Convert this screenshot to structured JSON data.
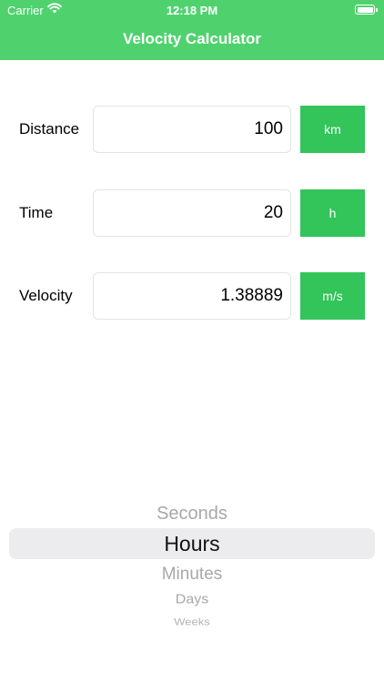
{
  "status_bar": {
    "carrier": "Carrier",
    "time": "12:18 PM",
    "wifi_icon": "wifi-icon",
    "battery_icon": "battery-icon"
  },
  "nav": {
    "title": "Velocity Calculator"
  },
  "colors": {
    "header": "#4fd26e",
    "unit_button": "#33c45a"
  },
  "rows": [
    {
      "label": "Distance",
      "value": "100",
      "unit": "km"
    },
    {
      "label": "Time",
      "value": "20",
      "unit": "h"
    },
    {
      "label": "Velocity",
      "value": "1.38889",
      "unit": "m/s"
    }
  ],
  "picker": {
    "options": [
      "Seconds",
      "Hours",
      "Minutes",
      "Days",
      "Weeks"
    ],
    "selected": "Hours"
  }
}
